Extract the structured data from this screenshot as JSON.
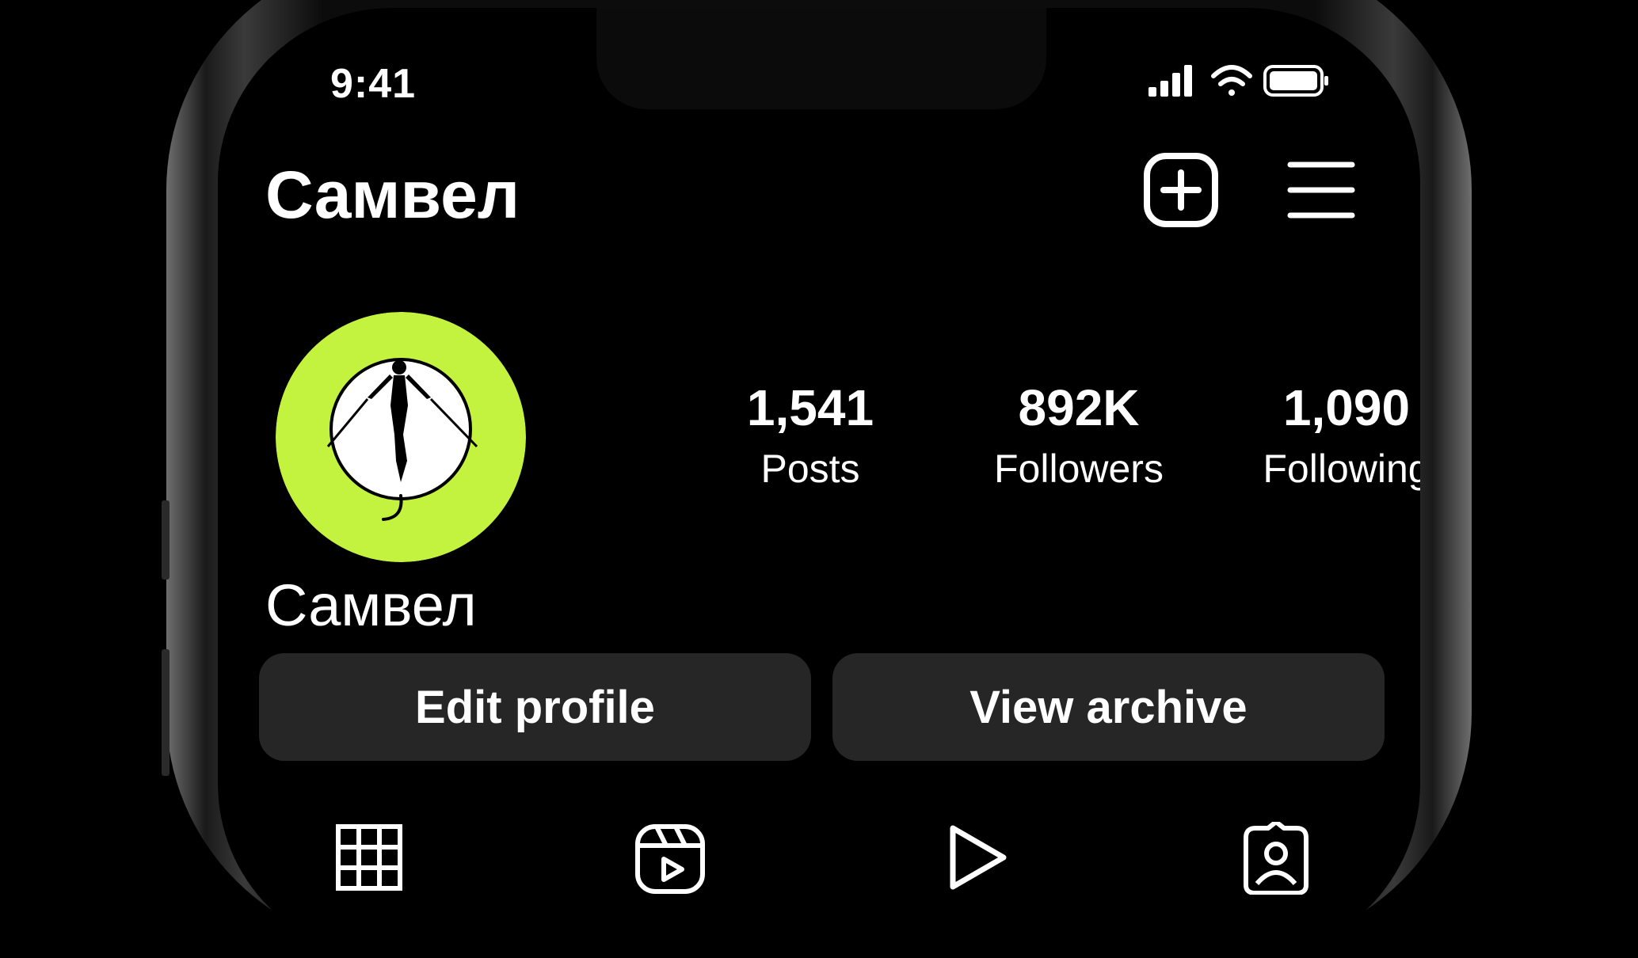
{
  "status_bar": {
    "time": "9:41"
  },
  "header": {
    "username": "Самвел",
    "icons": [
      "add-post-icon",
      "menu-icon"
    ]
  },
  "profile": {
    "avatar": "avatar",
    "accent_color": "#c3f33e",
    "display_name": "Самвел",
    "stats": [
      {
        "value": "1,541",
        "label": "Posts"
      },
      {
        "value": "892K",
        "label": "Followers"
      },
      {
        "value": "1,090",
        "label": "Following"
      }
    ]
  },
  "actions": {
    "edit_profile": "Edit profile",
    "view_archive": "View archive"
  },
  "tabs": [
    "grid-icon",
    "reels-icon",
    "play-icon",
    "tagged-icon"
  ]
}
